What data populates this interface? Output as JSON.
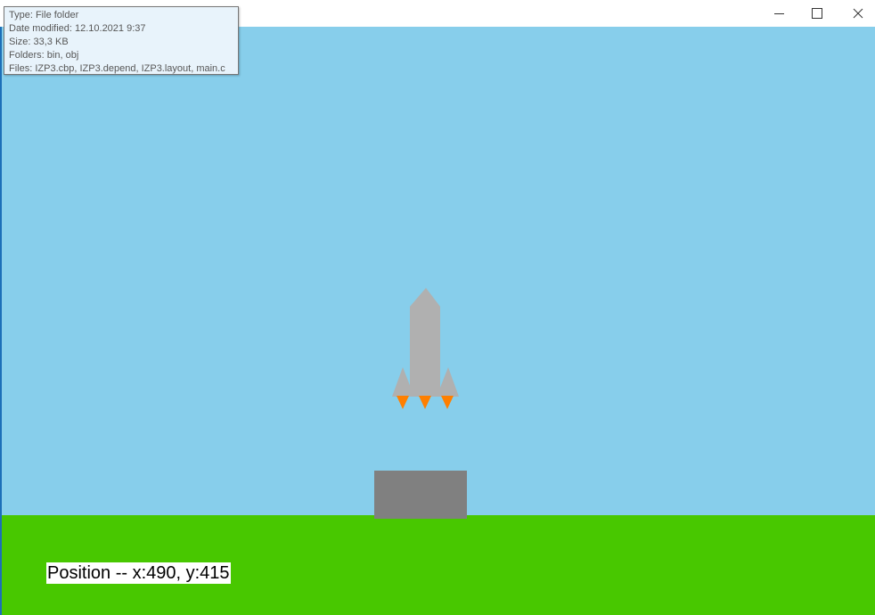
{
  "window": {
    "controls": {
      "minimize": "minimize-icon",
      "maximize": "maximize-icon",
      "close": "close-icon"
    }
  },
  "tooltip": {
    "type": "Type: File folder",
    "date_modified": "Date modified: 12.10.2021 9:37",
    "size": "Size: 33,3 KB",
    "folders": "Folders: bin, obj",
    "files": "Files: IZP3.cbp, IZP3.depend, IZP3.layout, main.c"
  },
  "game": {
    "position_text": "Position -- x:490, y:415",
    "colors": {
      "sky": "#87ceeb",
      "ground": "#48c800",
      "pad": "#808080",
      "rocket_body": "#b0b0b0",
      "flame": "#ff7f00"
    }
  }
}
